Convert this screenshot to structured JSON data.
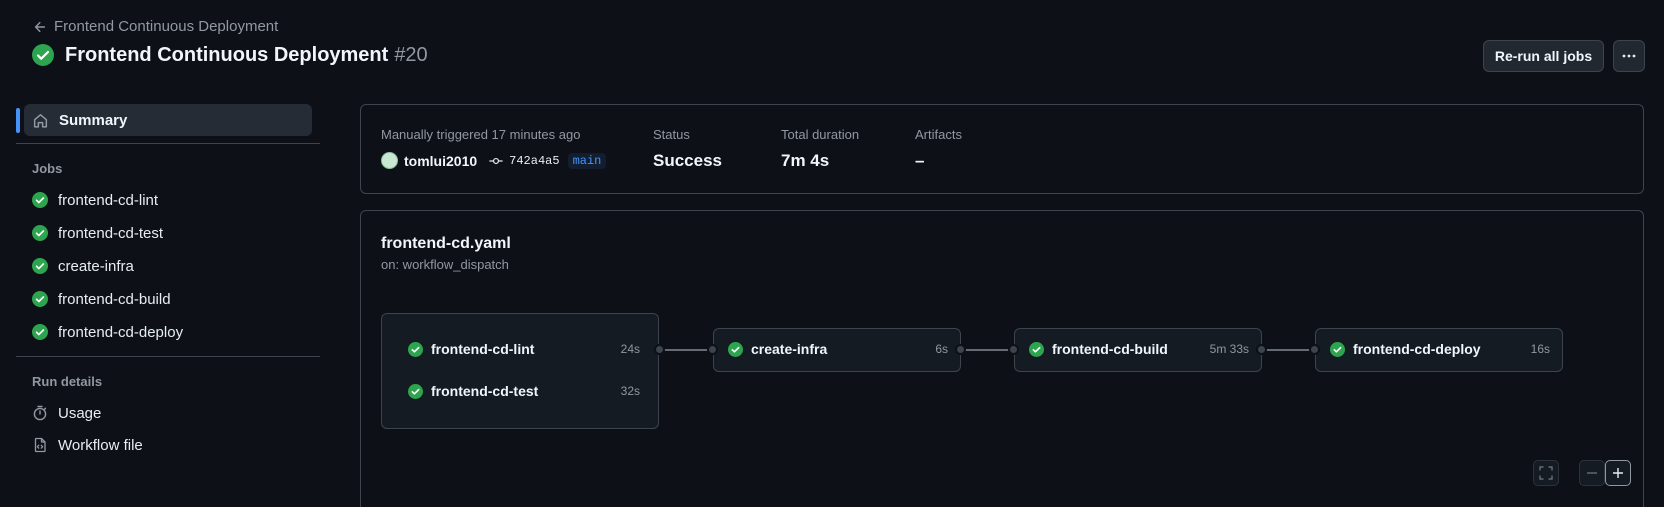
{
  "header": {
    "back_label": "Frontend Continuous Deployment",
    "title": "Frontend Continuous Deployment",
    "run_number": "#20",
    "rerun_label": "Re-run all jobs",
    "more_label": "···"
  },
  "sidebar": {
    "summary_label": "Summary",
    "jobs_heading": "Jobs",
    "jobs": [
      {
        "label": "frontend-cd-lint"
      },
      {
        "label": "frontend-cd-test"
      },
      {
        "label": "create-infra"
      },
      {
        "label": "frontend-cd-build"
      },
      {
        "label": "frontend-cd-deploy"
      }
    ],
    "run_details_heading": "Run details",
    "usage_label": "Usage",
    "workflow_file_label": "Workflow file"
  },
  "summary": {
    "trigger_text": "Manually triggered 17 minutes ago",
    "actor": "tomlui2010",
    "commit_sha": "742a4a5",
    "branch": "main",
    "status_label": "Status",
    "status_value": "Success",
    "duration_label": "Total duration",
    "duration_value": "7m 4s",
    "artifacts_label": "Artifacts",
    "artifacts_value": "–"
  },
  "workflow": {
    "file_name": "frontend-cd.yaml",
    "trigger": "on: workflow_dispatch",
    "group_jobs": [
      {
        "name": "frontend-cd-lint",
        "duration": "24s"
      },
      {
        "name": "frontend-cd-test",
        "duration": "32s"
      }
    ],
    "jobs": [
      {
        "name": "create-infra",
        "duration": "6s"
      },
      {
        "name": "frontend-cd-build",
        "duration": "5m 33s"
      },
      {
        "name": "frontend-cd-deploy",
        "duration": "16s"
      }
    ]
  },
  "colors": {
    "success": "#2da44e",
    "accent": "#4493f8",
    "background": "#0d1117"
  },
  "icons": {
    "back": "arrow-left-icon",
    "status": "check-circle-fill-icon",
    "summary": "home-icon",
    "usage": "stopwatch-icon",
    "workflow_file": "file-code-icon",
    "commit": "git-commit-icon"
  }
}
